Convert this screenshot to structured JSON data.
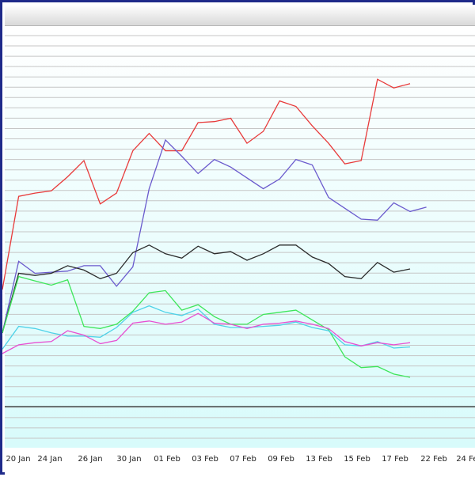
{
  "window": {
    "title": ""
  },
  "chart_data": {
    "type": "line",
    "title": "",
    "xlabel": "",
    "ylabel": "",
    "grid": true,
    "x_tick_labels": [
      "20 Jan",
      "24 Jan",
      "26 Jan",
      "30 Jan",
      "01 Feb",
      "03 Feb",
      "07 Feb",
      "09 Feb",
      "13 Feb",
      "15 Feb",
      "17 Feb",
      "22 Feb",
      "24 Feb"
    ],
    "x": [
      0,
      1,
      2,
      3,
      4,
      5,
      6,
      7,
      8,
      9,
      10,
      11,
      12,
      13,
      14,
      15,
      16,
      17,
      18,
      19,
      20,
      21,
      22,
      23,
      24,
      25,
      26,
      27,
      28,
      29
    ],
    "ylim": [
      0,
      30
    ],
    "series": [
      {
        "color": "#e83a3a",
        "values": [
          10.8,
          19.4,
          19.7,
          19.9,
          21.2,
          22.7,
          18.7,
          19.7,
          23.6,
          25.2,
          23.6,
          23.6,
          26.2,
          26.3,
          26.6,
          24.3,
          25.4,
          28.2,
          27.7,
          25.9,
          24.3,
          22.4,
          22.7,
          30.2,
          29.4,
          29.8
        ]
      },
      {
        "color": "#6a5acd",
        "values": [
          6.8,
          13.4,
          12.3,
          12.4,
          12.5,
          13.0,
          13.0,
          11.1,
          12.9,
          20.1,
          24.6,
          23.1,
          21.5,
          22.8,
          22.1,
          21.1,
          20.1,
          21.0,
          22.8,
          22.3,
          19.3,
          18.3,
          17.3,
          17.2,
          18.8,
          18.0,
          18.4
        ]
      },
      {
        "color": "#2b2b2b",
        "values": [
          6.8,
          12.3,
          12.1,
          12.3,
          13.0,
          12.6,
          11.8,
          12.3,
          14.2,
          14.9,
          14.1,
          13.7,
          14.8,
          14.1,
          14.3,
          13.5,
          14.1,
          14.9,
          14.9,
          13.8,
          13.2,
          12.0,
          11.8,
          13.3,
          12.4,
          12.7
        ]
      },
      {
        "color": "#3ee65a",
        "values": [
          6.8,
          12.0,
          11.6,
          11.2,
          11.7,
          7.4,
          7.2,
          7.6,
          8.8,
          10.5,
          10.7,
          8.9,
          9.4,
          8.3,
          7.6,
          7.6,
          8.5,
          8.7,
          8.9,
          8.0,
          7.1,
          4.6,
          3.6,
          3.7,
          3.0,
          2.7
        ]
      },
      {
        "color": "#4fd2e8",
        "values": [
          5.3,
          7.4,
          7.2,
          6.8,
          6.5,
          6.5,
          6.4,
          7.3,
          8.7,
          9.3,
          8.7,
          8.4,
          9.0,
          7.6,
          7.3,
          7.3,
          7.4,
          7.5,
          7.8,
          7.3,
          7.0,
          5.7,
          5.6,
          6.0,
          5.4,
          5.5
        ]
      },
      {
        "color": "#e84fd2",
        "values": [
          4.9,
          5.7,
          5.9,
          6.0,
          7.0,
          6.6,
          5.8,
          6.1,
          7.7,
          7.9,
          7.6,
          7.8,
          8.6,
          7.7,
          7.6,
          7.2,
          7.6,
          7.7,
          7.9,
          7.6,
          7.2,
          6.0,
          5.6,
          5.9,
          5.7,
          5.9
        ]
      }
    ]
  }
}
